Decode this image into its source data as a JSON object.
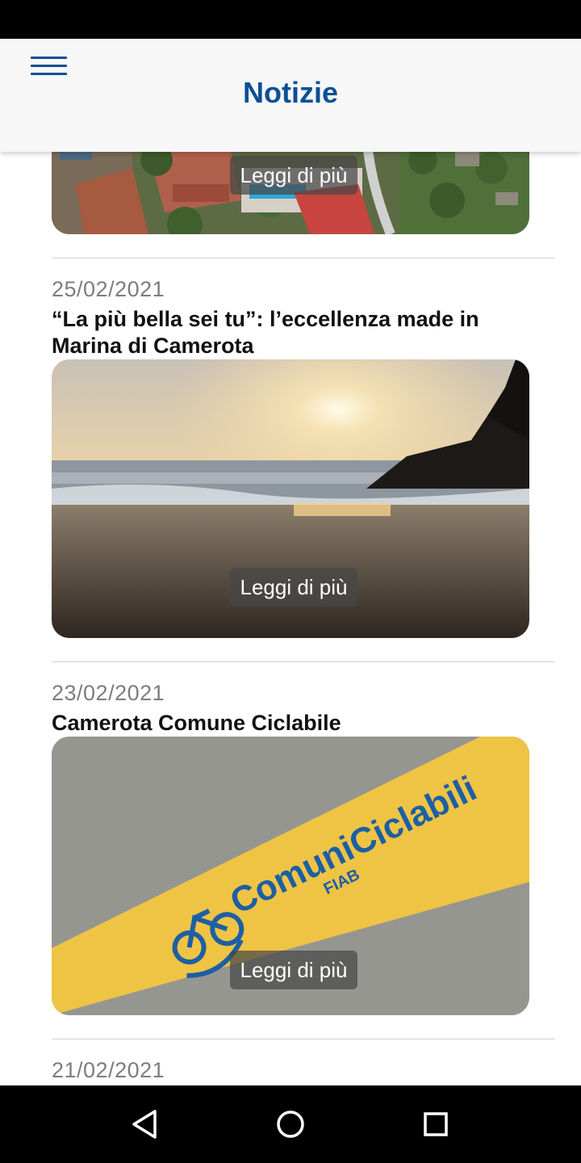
{
  "header": {
    "title": "Notizie",
    "menu_icon": "hamburger-menu-icon",
    "accent": "#0d4f95"
  },
  "news": [
    {
      "date": "",
      "title": "",
      "read_more": "Leggi di più"
    },
    {
      "date": "25/02/2021",
      "title": "“La più bella sei tu”: l’eccellenza made in Marina di Camerota",
      "read_more": "Leggi di più"
    },
    {
      "date": "23/02/2021",
      "title": "Camerota Comune Ciclabile",
      "read_more": "Leggi di più",
      "image_text": "ComuniCiclabili",
      "image_subtext": "FIAB"
    },
    {
      "date": "21/02/2021"
    }
  ],
  "navbar": {
    "icons": [
      "back-triangle-icon",
      "home-circle-icon",
      "recents-square-icon"
    ]
  }
}
